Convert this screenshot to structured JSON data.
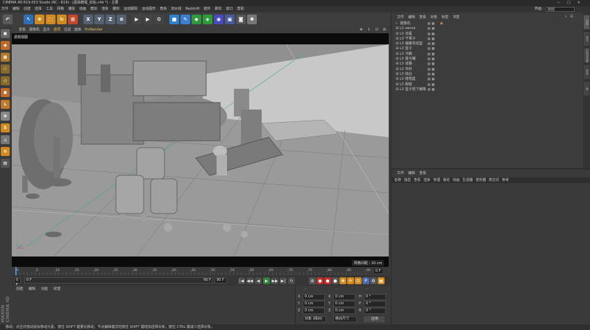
{
  "window": {
    "title": "CINEMA 4D R19.053 Studio (RC - R19) - [基础教程_初始.c4d *] - 主要",
    "controls": [
      "—",
      "□",
      "✕"
    ]
  },
  "menubar": {
    "items": [
      "文件",
      "编辑",
      "创建",
      "选择",
      "工具",
      "网格",
      "捕捉",
      "动画",
      "模拟",
      "渲染",
      "雕刻",
      "运动跟踪",
      "运动图形",
      "角色",
      "流水线",
      "Redshift",
      "插件",
      "脚本",
      "窗口",
      "帮助"
    ],
    "layout_label": "界面:",
    "layout_value": "启动"
  },
  "toolbar": {
    "buttons": [
      {
        "name": "undo-button",
        "glyph": "↶",
        "color": "#5a5a5a"
      },
      {
        "name": "live-select-button",
        "glyph": "↖",
        "color": "#2f6fb5"
      },
      {
        "name": "move-button",
        "glyph": "✥",
        "color": "#d08a1e"
      },
      {
        "name": "scale-button",
        "glyph": "⬚",
        "color": "#d08a1e"
      },
      {
        "name": "rotate-button",
        "glyph": "↻",
        "color": "#d08a1e"
      },
      {
        "name": "recent-tool-button",
        "glyph": "⊞",
        "color": "#c24a2a"
      },
      {
        "name": "x-axis-button",
        "glyph": "X",
        "color": "#556070"
      },
      {
        "name": "y-axis-button",
        "glyph": "Y",
        "color": "#556070"
      },
      {
        "name": "z-axis-button",
        "glyph": "Z",
        "color": "#556070"
      },
      {
        "name": "coord-system-button",
        "glyph": "⊕",
        "color": "#556070"
      },
      {
        "name": "render-view-button",
        "glyph": "▶",
        "color": "#444"
      },
      {
        "name": "render-picture-viewer-button",
        "glyph": "▶",
        "color": "#444"
      },
      {
        "name": "render-settings-button",
        "glyph": "⚙",
        "color": "#444"
      },
      {
        "name": "cube-button",
        "glyph": "■",
        "color": "#2f7fd0"
      },
      {
        "name": "pen-button",
        "glyph": "✎",
        "color": "#3a7fd0"
      },
      {
        "name": "subdivision-button",
        "glyph": "◆",
        "color": "#2e9a3a"
      },
      {
        "name": "array-button",
        "glyph": "◈",
        "color": "#2e9a3a"
      },
      {
        "name": "deformer-button",
        "glyph": "◉",
        "color": "#4a4ac0"
      },
      {
        "name": "scene-button",
        "glyph": "▣",
        "color": "#4a5a9a"
      },
      {
        "name": "camera-button",
        "glyph": "◙",
        "color": "#555"
      },
      {
        "name": "light-button",
        "glyph": "✺",
        "color": "#777"
      }
    ]
  },
  "left_tools": [
    {
      "name": "make-editable-button",
      "glyph": "▣",
      "color": "#666"
    },
    {
      "name": "model-mode-button",
      "glyph": "◆",
      "color": "#c06a2a"
    },
    {
      "name": "texture-mode-button",
      "glyph": "▦",
      "color": "#b07a2a"
    },
    {
      "name": "points-mode-button",
      "glyph": "⁘",
      "color": "#8a6a2a"
    },
    {
      "name": "edges-mode-button",
      "glyph": "◇",
      "color": "#8a6a2a"
    },
    {
      "name": "polygons-mode-button",
      "glyph": "◼",
      "color": "#c06a2a"
    },
    {
      "name": "axis-mode-button",
      "glyph": "L",
      "color": "#c0782a"
    },
    {
      "name": "tweak-mode-button",
      "glyph": "⊕",
      "color": "#888"
    },
    {
      "name": "snap-button",
      "glyph": "S",
      "color": "#d08a1e"
    },
    {
      "name": "workplane-button",
      "glyph": "◬",
      "color": "#777"
    },
    {
      "name": "lock-workplane-button",
      "glyph": "⊘",
      "color": "#d08a1e"
    },
    {
      "name": "planar-workplane-button",
      "glyph": "▤",
      "color": "#555"
    }
  ],
  "viewport": {
    "menu": [
      "查看",
      "摄像机",
      "显示",
      "选项",
      "过滤",
      "面板",
      "ProRender"
    ],
    "active_menu": "选项",
    "label": "透视视图",
    "grid_readout": "网格间距 : 10 cm",
    "icons": [
      "✥",
      "⇕",
      "⊡",
      "⊞"
    ]
  },
  "timeline": {
    "ticks": [
      "0",
      "5",
      "10",
      "15",
      "20",
      "25",
      "30",
      "35",
      "40",
      "45",
      "50",
      "55",
      "60",
      "65",
      "70",
      "75",
      "80",
      "85",
      "90"
    ],
    "current_frame": "0 F"
  },
  "playback": {
    "start_field": "0 F",
    "end_field_a": "90 F",
    "end_field_b": "90 F",
    "slider_value": "0 F",
    "buttons": [
      "|◀",
      "◀◀",
      "◀",
      "▶",
      "▶▶",
      "▶|",
      "↻"
    ],
    "key_buttons": [
      "⊘",
      "●",
      "●",
      "●",
      "✥",
      "⟳",
      "⊡",
      "P",
      "⚙",
      "▦"
    ]
  },
  "material": {
    "tabs": [
      "创建",
      "编辑",
      "功能",
      "纹理"
    ]
  },
  "maxon_logo": "MAXON CINEMA 4D",
  "coords": {
    "rows": [
      {
        "axis": "X",
        "pos": "0 cm",
        "axis2": "X",
        "size": "0 cm",
        "axis3": "H",
        "rot": "0 °"
      },
      {
        "axis": "Y",
        "pos": "0 cm",
        "axis2": "Y",
        "size": "0 cm",
        "axis3": "P",
        "rot": "0 °"
      },
      {
        "axis": "Z",
        "pos": "0 cm",
        "axis2": "Z",
        "size": "0 cm",
        "axis3": "B",
        "rot": "0 °"
      }
    ],
    "mode_select": "对象 (相对)",
    "size_select": "绝对尺寸",
    "apply_button": "应用"
  },
  "status": {
    "text": "移动：点击并拖动鼠标移动元素。按住 SHIFT 键量化移动；节点编辑模式时按住 SHIFT 键增加选择对象；按住 CTRL 键减少选择对象。"
  },
  "object_manager": {
    "tabs": [
      "文件",
      "编辑",
      "查看",
      "对象",
      "标签",
      "书签"
    ],
    "items": [
      {
        "label": "摄像机",
        "glyph": "⊢"
      },
      {
        "label": "sence",
        "glyph": "⊞ L0"
      },
      {
        "label": "花瓶",
        "glyph": "⊞ L0"
      },
      {
        "label": "干果子",
        "glyph": "⊞ L0"
      },
      {
        "label": "编藤花纹篮",
        "glyph": "⊞ L0"
      },
      {
        "label": "篮子",
        "glyph": "⊞ L0"
      },
      {
        "label": "书籍",
        "glyph": "⊞ L0"
      },
      {
        "label": "瓶与罐",
        "glyph": "⊞ L0"
      },
      {
        "label": "道路",
        "glyph": "⊞ L0"
      },
      {
        "label": "布料",
        "glyph": "⊞ L0"
      },
      {
        "label": "烛台",
        "glyph": "⊞ L0"
      },
      {
        "label": "植物篮",
        "glyph": "⊞ L0"
      },
      {
        "label": "橱窗",
        "glyph": "⊞ L0"
      },
      {
        "label": "篮子轻下编格",
        "glyph": "⊞ L0"
      }
    ]
  },
  "side_tabs": [
    "对象",
    "场次",
    "内容浏览器",
    "构造",
    "层"
  ],
  "attribute_manager": {
    "tabs": [
      "文件",
      "编辑",
      "查看"
    ],
    "columns": [
      "名称",
      "S",
      "V",
      "R",
      "M",
      "L",
      "A",
      "G",
      "D",
      "E",
      "X"
    ],
    "column_labels": [
      "名称",
      "独显",
      "查看",
      "渲染",
      "管理",
      "锁定",
      "动画",
      "生成器",
      "变形器",
      "表达式",
      "参考"
    ]
  }
}
